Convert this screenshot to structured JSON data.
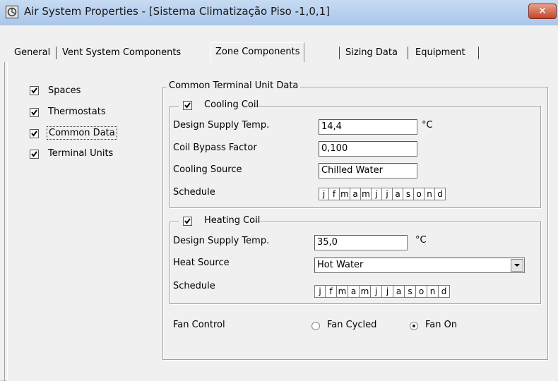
{
  "window": {
    "title": "Air System Properties - [Sistema Climatização Piso -1,0,1]",
    "close_label": "✕"
  },
  "tabs": [
    {
      "label": "General"
    },
    {
      "label": "Vent System Components"
    },
    {
      "label": "Zone Components"
    },
    {
      "label": "Sizing Data"
    },
    {
      "label": "Equipment"
    }
  ],
  "sidebar": {
    "items": [
      {
        "label": "Spaces",
        "checked": true
      },
      {
        "label": "Thermostats",
        "checked": true
      },
      {
        "label": "Common Data",
        "checked": true
      },
      {
        "label": "Terminal Units",
        "checked": true
      }
    ]
  },
  "common": {
    "group_title": "Common Terminal Unit Data",
    "cooling": {
      "title": "Cooling Coil",
      "checked": true,
      "supply_temp_label": "Design Supply Temp.",
      "supply_temp_value": "14,4",
      "supply_temp_unit": "°C",
      "bypass_label": "Coil Bypass Factor",
      "bypass_value": "0,100",
      "source_label": "Cooling Source",
      "source_value": "Chilled Water",
      "schedule_label": "Schedule",
      "months": [
        "j",
        "f",
        "m",
        "a",
        "m",
        "j",
        "j",
        "a",
        "s",
        "o",
        "n",
        "d"
      ]
    },
    "heating": {
      "title": "Heating Coil",
      "checked": true,
      "supply_temp_label": "Design Supply Temp.",
      "supply_temp_value": "35,0",
      "supply_temp_unit": "°C",
      "source_label": "Heat Source",
      "source_value": "Hot Water",
      "schedule_label": "Schedule",
      "months": [
        "j",
        "f",
        "m",
        "a",
        "m",
        "j",
        "j",
        "a",
        "s",
        "o",
        "n",
        "d"
      ]
    },
    "fan": {
      "label": "Fan Control",
      "options": [
        {
          "label": "Fan Cycled",
          "selected": false
        },
        {
          "label": "Fan On",
          "selected": true
        }
      ]
    }
  }
}
